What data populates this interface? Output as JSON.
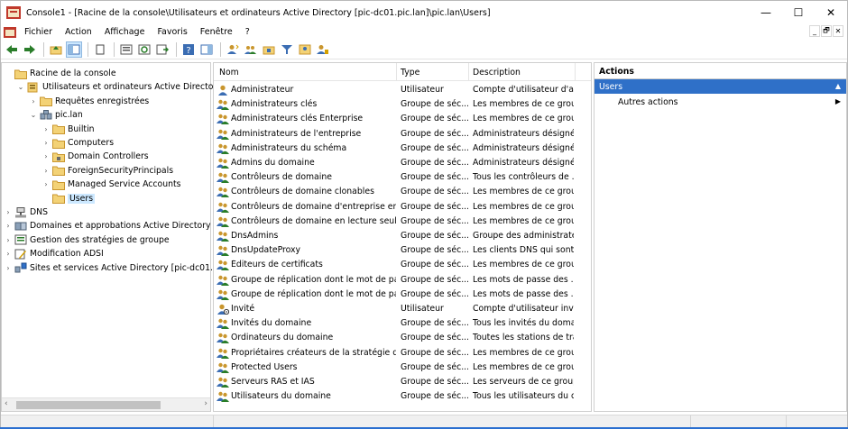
{
  "window": {
    "title": "Console1 - [Racine de la console\\Utilisateurs et ordinateurs Active Directory [pic-dc01.pic.lan]\\pic.lan\\Users]",
    "minimize": "—",
    "maximize": "☐",
    "close": "✕"
  },
  "menu": [
    "Fichier",
    "Action",
    "Affichage",
    "Favoris",
    "Fenêtre",
    "?"
  ],
  "mdi_buttons": [
    "_",
    "🗗",
    "✕"
  ],
  "tree": [
    {
      "label": "Racine de la console",
      "indent": 0,
      "expander": "",
      "icon": "folder-icon"
    },
    {
      "label": "Utilisateurs et ordinateurs Active Directory [pic",
      "indent": 1,
      "expander": "⌄",
      "icon": "ad-icon"
    },
    {
      "label": "Requêtes enregistrées",
      "indent": 2,
      "expander": "›",
      "icon": "folder-icon"
    },
    {
      "label": "pic.lan",
      "indent": 2,
      "expander": "⌄",
      "icon": "domain-icon"
    },
    {
      "label": "Builtin",
      "indent": 3,
      "expander": "›",
      "icon": "folder-icon"
    },
    {
      "label": "Computers",
      "indent": 3,
      "expander": "›",
      "icon": "folder-icon"
    },
    {
      "label": "Domain Controllers",
      "indent": 3,
      "expander": "›",
      "icon": "ou-icon"
    },
    {
      "label": "ForeignSecurityPrincipals",
      "indent": 3,
      "expander": "›",
      "icon": "folder-icon"
    },
    {
      "label": "Managed Service Accounts",
      "indent": 3,
      "expander": "›",
      "icon": "folder-icon"
    },
    {
      "label": "Users",
      "indent": 3,
      "expander": "",
      "icon": "folder-icon",
      "selected": true
    },
    {
      "label": "DNS",
      "indent": 0,
      "expander": "›",
      "icon": "dns-icon"
    },
    {
      "label": "Domaines et approbations Active Directory",
      "indent": 0,
      "expander": "›",
      "icon": "trust-icon"
    },
    {
      "label": "Gestion des stratégies de groupe",
      "indent": 0,
      "expander": "›",
      "icon": "gpo-icon"
    },
    {
      "label": "Modification ADSI",
      "indent": 0,
      "expander": "›",
      "icon": "adsi-icon"
    },
    {
      "label": "Sites et services Active Directory [pic-dc01.pic.l",
      "indent": 0,
      "expander": "›",
      "icon": "sites-icon"
    }
  ],
  "list": {
    "columns": [
      "Nom",
      "Type",
      "Description"
    ],
    "rows": [
      {
        "name": "Administrateur",
        "type": "Utilisateur",
        "desc": "Compte d'utilisateur d'a...",
        "icon": "user-icon"
      },
      {
        "name": "Administrateurs clés",
        "type": "Groupe de séc...",
        "desc": "Les membres de ce grou...",
        "icon": "group-icon"
      },
      {
        "name": "Administrateurs clés Enterprise",
        "type": "Groupe de séc...",
        "desc": "Les membres de ce grou...",
        "icon": "group-icon"
      },
      {
        "name": "Administrateurs de l'entreprise",
        "type": "Groupe de séc...",
        "desc": "Administrateurs désigné...",
        "icon": "group-icon"
      },
      {
        "name": "Administrateurs du schéma",
        "type": "Groupe de séc...",
        "desc": "Administrateurs désigné...",
        "icon": "group-icon"
      },
      {
        "name": "Admins du domaine",
        "type": "Groupe de séc...",
        "desc": "Administrateurs désigné...",
        "icon": "group-icon"
      },
      {
        "name": "Contrôleurs de domaine",
        "type": "Groupe de séc...",
        "desc": "Tous les contrôleurs de ...",
        "icon": "group-icon"
      },
      {
        "name": "Contrôleurs de domaine clonables",
        "type": "Groupe de séc...",
        "desc": "Les membres de ce grou...",
        "icon": "group-icon"
      },
      {
        "name": "Contrôleurs de domaine d'entreprise en le...",
        "type": "Groupe de séc...",
        "desc": "Les membres de ce grou...",
        "icon": "group-icon"
      },
      {
        "name": "Contrôleurs de domaine en lecture seule",
        "type": "Groupe de séc...",
        "desc": "Les membres de ce grou...",
        "icon": "group-icon"
      },
      {
        "name": "DnsAdmins",
        "type": "Groupe de séc...",
        "desc": "Groupe des administrate...",
        "icon": "group-icon"
      },
      {
        "name": "DnsUpdateProxy",
        "type": "Groupe de séc...",
        "desc": "Les clients DNS qui sont ...",
        "icon": "group-icon"
      },
      {
        "name": "Éditeurs de certificats",
        "type": "Groupe de séc...",
        "desc": "Les membres de ce grou...",
        "icon": "group-icon"
      },
      {
        "name": "Groupe de réplication dont le mot de pass...",
        "type": "Groupe de séc...",
        "desc": "Les mots de passe des ...",
        "icon": "group-icon"
      },
      {
        "name": "Groupe de réplication dont le mot de pass...",
        "type": "Groupe de séc...",
        "desc": "Les mots de passe des ...",
        "icon": "group-icon"
      },
      {
        "name": "Invité",
        "type": "Utilisateur",
        "desc": "Compte d'utilisateur inv...",
        "icon": "user-disabled-icon"
      },
      {
        "name": "Invités du domaine",
        "type": "Groupe de séc...",
        "desc": "Tous les invités du doma...",
        "icon": "group-icon"
      },
      {
        "name": "Ordinateurs du domaine",
        "type": "Groupe de séc...",
        "desc": "Toutes les stations de tra...",
        "icon": "group-icon"
      },
      {
        "name": "Propriétaires créateurs de la stratégie de g...",
        "type": "Groupe de séc...",
        "desc": "Les membres de ce grou...",
        "icon": "group-icon"
      },
      {
        "name": "Protected Users",
        "type": "Groupe de séc...",
        "desc": "Les membres de ce grou...",
        "icon": "group-icon"
      },
      {
        "name": "Serveurs RAS et IAS",
        "type": "Groupe de séc...",
        "desc": "Les serveurs de ce group...",
        "icon": "group-icon"
      },
      {
        "name": "Utilisateurs du domaine",
        "type": "Groupe de séc...",
        "desc": "Tous les utilisateurs du d...",
        "icon": "group-icon"
      }
    ]
  },
  "actions": {
    "title": "Actions",
    "selected": "Users",
    "item": "Autres actions"
  },
  "colors": {
    "accent": "#2f70c8",
    "selection": "#cce8ff",
    "folder": "#f3d276"
  }
}
